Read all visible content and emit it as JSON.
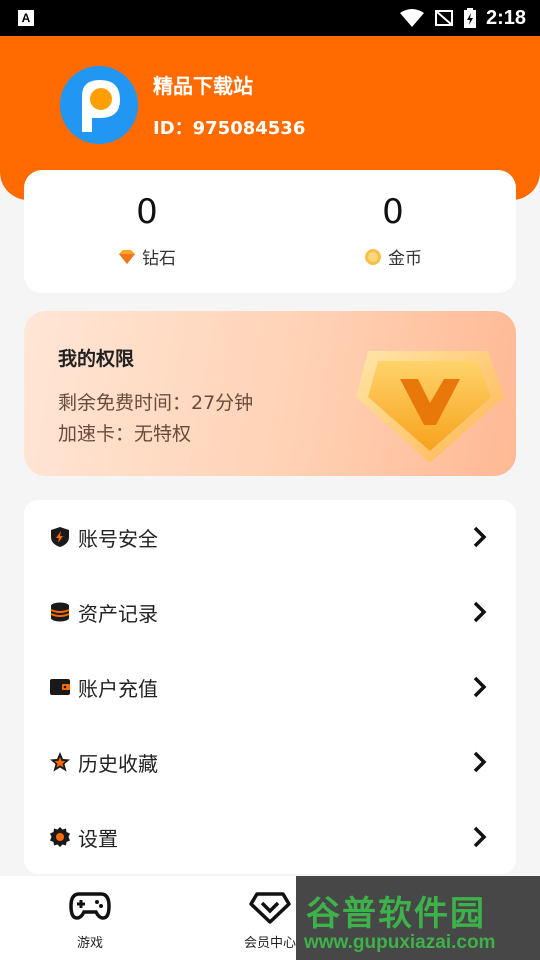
{
  "status_bar": {
    "time": "2:18",
    "app_icon_letter": "A"
  },
  "profile": {
    "name": "精品下载站",
    "id_text": "ID：975084536"
  },
  "balance": [
    {
      "value": "0",
      "label": "钻石",
      "icon": "diamond-icon"
    },
    {
      "value": "0",
      "label": "金币",
      "icon": "coin-icon"
    }
  ],
  "permissions": {
    "title": "我的权限",
    "free_time": "剩余免费时间：27分钟",
    "speed_card": "加速卡：无特权"
  },
  "menu": [
    {
      "label": "账号安全",
      "icon": "shield-icon"
    },
    {
      "label": "资产记录",
      "icon": "database-icon"
    },
    {
      "label": "账户充值",
      "icon": "wallet-icon"
    },
    {
      "label": "历史收藏",
      "icon": "star-icon"
    },
    {
      "label": "设置",
      "icon": "gear-icon"
    }
  ],
  "bottom_nav": [
    {
      "label": "游戏",
      "icon": "gamepad-icon"
    },
    {
      "label": "会员中心",
      "icon": "vip-diamond-icon"
    }
  ],
  "watermark": {
    "logo": "谷普软件园",
    "url": "www.gupuxiazai.com"
  },
  "colors": {
    "accent": "#ff6b00",
    "background": "#f5f5f5",
    "watermark_green": "#3db24a"
  }
}
